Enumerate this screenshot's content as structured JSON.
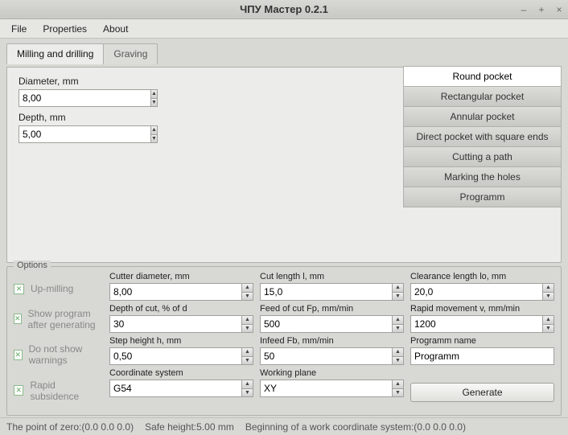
{
  "window": {
    "title": "ЧПУ Мастер 0.2.1"
  },
  "menu": {
    "file": "File",
    "properties": "Properties",
    "about": "About"
  },
  "tabs": {
    "milling": "Milling and drilling",
    "graving": "Graving"
  },
  "form": {
    "diameter_label": "Diameter, mm",
    "diameter_value": "8,00",
    "depth_label": "Depth, mm",
    "depth_value": "5,00"
  },
  "ops": {
    "round": "Round pocket",
    "rect": "Rectangular pocket",
    "annular": "Annular pocket",
    "direct": "Direct pocket with square ends",
    "path": "Cutting a path",
    "marking": "Marking the holes",
    "programm": "Programm"
  },
  "options": {
    "legend": "Options",
    "up_milling": "Up-milling",
    "show_program": "Show program after generating",
    "no_warnings": "Do not show warnings",
    "rapid_sub": "Rapid subsidence",
    "cutter_d_label": "Cutter diameter, mm",
    "cutter_d_value": "8,00",
    "depth_cut_label": "Depth of cut, % of d",
    "depth_cut_value": "30",
    "step_h_label": "Step height h, mm",
    "step_h_value": "0,50",
    "coord_label": "Coordinate system",
    "coord_value": "G54",
    "cut_len_label": "Cut length l, mm",
    "cut_len_value": "15,0",
    "feed_fp_label": "Feed of cut Fp, mm/min",
    "feed_fp_value": "500",
    "infeed_label": "Infeed Fb, mm/min",
    "infeed_value": "50",
    "plane_label": "Working plane",
    "plane_value": "XY",
    "clearance_label": "Clearance length lo, mm",
    "clearance_value": "20,0",
    "rapid_v_label": "Rapid movement v, mm/min",
    "rapid_v_value": "1200",
    "progname_label": "Programm name",
    "progname_value": "Programm",
    "generate": "Generate"
  },
  "status": {
    "zero": "The point of zero:(0.0  0.0  0.0)",
    "safe": "Safe height:5.00 mm",
    "wcs": "Beginning of a work coordinate system:(0.0  0.0  0.0)"
  }
}
